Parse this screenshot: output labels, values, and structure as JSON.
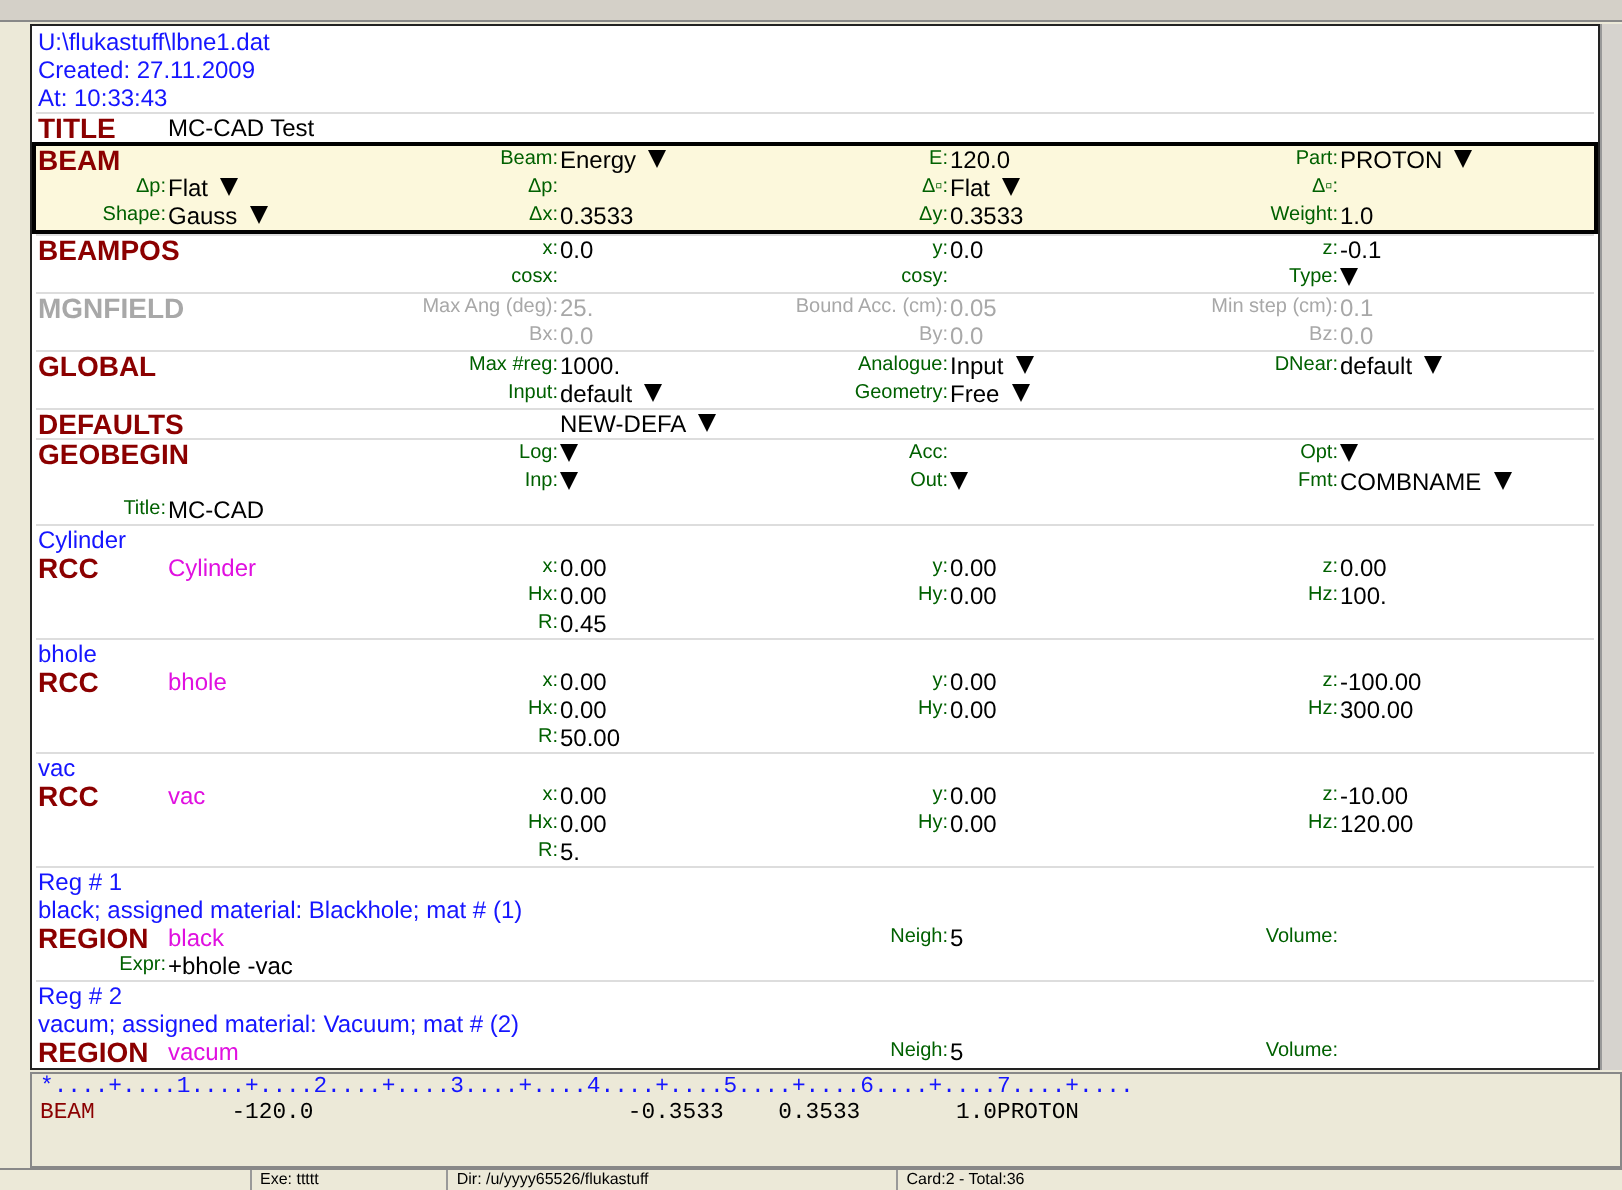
{
  "file_info": [
    "U:\\flukastuff\\lbne1.dat",
    "Created: 27.11.2009",
    "At: 10:33:43"
  ],
  "cards": [
    {
      "selected": false,
      "disabled": false,
      "rows": [
        {
          "name": "TITLE",
          "side": {
            "kind": "entry",
            "value": "MC-CAD Test"
          }
        }
      ]
    },
    {
      "selected": true,
      "disabled": false,
      "rows": [
        {
          "name": "BEAM",
          "col_1": {
            "kind": "choice",
            "label": "Beam:",
            "value": "Energy"
          },
          "col_2": {
            "kind": "entry",
            "label": "E:",
            "value": "120.0"
          },
          "col_3": {
            "kind": "choice",
            "label": "Part:",
            "value": "PROTON"
          }
        },
        {
          "side": {
            "kind": "choice",
            "label": "Δp:",
            "value": "Flat"
          },
          "col_1": {
            "kind": "entry",
            "label": "Δp:"
          },
          "col_2": {
            "kind": "choice",
            "label": "Δ▫:",
            "value": "Flat"
          },
          "col_3": {
            "kind": "entry",
            "label": "Δ▫:"
          }
        },
        {
          "side": {
            "kind": "choice",
            "label": "Shape:",
            "value": "Gauss"
          },
          "col_1": {
            "kind": "entry",
            "label": "Δx:",
            "value": "0.3533"
          },
          "col_2": {
            "kind": "entry",
            "label": "Δy:",
            "value": "0.3533"
          },
          "col_3": {
            "kind": "entry",
            "label": "Weight:",
            "value": "1.0"
          }
        }
      ]
    },
    {
      "selected": false,
      "disabled": false,
      "rows": [
        {
          "name": "BEAMPOS",
          "col_1": {
            "kind": "entry",
            "label": "x:",
            "value": "0.0"
          },
          "col_2": {
            "kind": "entry",
            "label": "y:",
            "value": "0.0"
          },
          "col_3": {
            "kind": "entry",
            "label": "z:",
            "value": "-0.1"
          }
        },
        {
          "col_1": {
            "kind": "entry",
            "label": "cosx:"
          },
          "col_2": {
            "kind": "entry",
            "label": "cosy:"
          },
          "col_3": {
            "kind": "choice",
            "label": "Type:"
          }
        }
      ]
    },
    {
      "selected": false,
      "disabled": true,
      "rows": [
        {
          "name": "MGNFIELD",
          "col_1": {
            "kind": "entry",
            "label": "Max Ang (deg):",
            "value": "25."
          },
          "col_2": {
            "kind": "entry",
            "label": "Bound Acc. (cm):",
            "value": "0.05"
          },
          "col_3": {
            "kind": "entry",
            "label": "Min step (cm):",
            "value": "0.1"
          }
        },
        {
          "col_1": {
            "kind": "entry",
            "label": "Bx:",
            "value": "0.0"
          },
          "col_2": {
            "kind": "entry",
            "label": "By:",
            "value": "0.0"
          },
          "col_3": {
            "kind": "entry",
            "label": "Bz:",
            "value": "0.0"
          }
        }
      ]
    },
    {
      "selected": false,
      "disabled": false,
      "rows": [
        {
          "name": "GLOBAL",
          "col_1": {
            "kind": "entry",
            "label": "Max #reg:",
            "value": "1000."
          },
          "col_2": {
            "kind": "choice",
            "label": "Analogue:",
            "value": "Input"
          },
          "col_3": {
            "kind": "choice",
            "label": "DNear:",
            "value": "default"
          }
        },
        {
          "col_1": {
            "kind": "choice",
            "label": "Input:",
            "value": "default"
          },
          "col_2": {
            "kind": "choice",
            "label": "Geometry:",
            "value": "Free"
          }
        }
      ]
    },
    {
      "selected": false,
      "disabled": false,
      "rows": [
        {
          "name": "DEFAULTS",
          "col_1": {
            "kind": "choice",
            "value": "NEW-DEFA"
          }
        }
      ]
    },
    {
      "selected": false,
      "disabled": false,
      "rows": [
        {
          "name": "GEOBEGIN",
          "col_1": {
            "kind": "choice",
            "label": "Log:"
          },
          "col_2": {
            "kind": "entry",
            "label": "Acc:"
          },
          "col_3": {
            "kind": "choice",
            "label": "Opt:"
          }
        },
        {
          "col_1": {
            "kind": "choice",
            "label": "Inp:"
          },
          "col_2": {
            "kind": "choice",
            "label": "Out:"
          },
          "col_3": {
            "kind": "choice",
            "label": "Fmt:",
            "value": "COMBNAME"
          }
        },
        {
          "side": {
            "kind": "entry",
            "label": "Title:",
            "value": "MC-CAD"
          }
        }
      ]
    },
    {
      "selected": false,
      "disabled": false,
      "notes": [
        "Cylinder"
      ],
      "rows": [
        {
          "name": "RCC",
          "tag": "Cylinder",
          "col_1": {
            "kind": "entry",
            "label": "x:",
            "value": "0.00"
          },
          "col_2": {
            "kind": "entry",
            "label": "y:",
            "value": "0.00"
          },
          "col_3": {
            "kind": "entry",
            "label": "z:",
            "value": "0.00"
          }
        },
        {
          "col_1": {
            "kind": "entry",
            "label": "Hx:",
            "value": "0.00"
          },
          "col_2": {
            "kind": "entry",
            "label": "Hy:",
            "value": "0.00"
          },
          "col_3": {
            "kind": "entry",
            "label": "Hz:",
            "value": "100."
          }
        },
        {
          "col_1": {
            "kind": "entry",
            "label": "R:",
            "value": "0.45"
          }
        }
      ]
    },
    {
      "selected": false,
      "disabled": false,
      "notes": [
        "bhole"
      ],
      "rows": [
        {
          "name": "RCC",
          "tag": "bhole",
          "col_1": {
            "kind": "entry",
            "label": "x:",
            "value": "0.00"
          },
          "col_2": {
            "kind": "entry",
            "label": "y:",
            "value": "0.00"
          },
          "col_3": {
            "kind": "entry",
            "label": "z:",
            "value": "-100.00"
          }
        },
        {
          "col_1": {
            "kind": "entry",
            "label": "Hx:",
            "value": "0.00"
          },
          "col_2": {
            "kind": "entry",
            "label": "Hy:",
            "value": "0.00"
          },
          "col_3": {
            "kind": "entry",
            "label": "Hz:",
            "value": "300.00"
          }
        },
        {
          "col_1": {
            "kind": "entry",
            "label": "R:",
            "value": "50.00"
          }
        }
      ]
    },
    {
      "selected": false,
      "disabled": false,
      "notes": [
        "vac"
      ],
      "rows": [
        {
          "name": "RCC",
          "tag": "vac",
          "col_1": {
            "kind": "entry",
            "label": "x:",
            "value": "0.00"
          },
          "col_2": {
            "kind": "entry",
            "label": "y:",
            "value": "0.00"
          },
          "col_3": {
            "kind": "entry",
            "label": "z:",
            "value": "-10.00"
          }
        },
        {
          "col_1": {
            "kind": "entry",
            "label": "Hx:",
            "value": "0.00"
          },
          "col_2": {
            "kind": "entry",
            "label": "Hy:",
            "value": "0.00"
          },
          "col_3": {
            "kind": "entry",
            "label": "Hz:",
            "value": "120.00"
          }
        },
        {
          "col_1": {
            "kind": "entry",
            "label": "R:",
            "value": "5."
          }
        }
      ]
    },
    {
      "selected": false,
      "disabled": false,
      "notes": [
        "Reg # 1",
        "black; assigned material: Blackhole; mat # (1)"
      ],
      "rows": [
        {
          "name": "REGION",
          "tag": "black",
          "col_2": {
            "kind": "entry",
            "label": "Neigh:",
            "value": "5"
          },
          "col_3": {
            "kind": "entry",
            "label": "Volume:"
          }
        },
        {
          "side": {
            "kind": "entry",
            "label": "Expr:",
            "value": "+bhole -vac"
          }
        }
      ]
    },
    {
      "selected": false,
      "disabled": false,
      "notes": [
        "Reg # 2",
        "vacum; assigned material: Vacuum; mat # (2)"
      ],
      "rows": [
        {
          "name": "REGION",
          "tag": "vacum",
          "col_2": {
            "kind": "entry",
            "label": "Neigh:",
            "value": "5"
          },
          "col_3": {
            "kind": "entry",
            "label": "Volume:"
          }
        }
      ]
    }
  ],
  "output": {
    "ruler": "*....+....1....+....2....+....3....+....4....+....5....+....6....+....7....+....",
    "card_name": "BEAM",
    "card_fields": "          -120.0                       -0.3533    0.3533       1.0PROTON"
  },
  "status_bar": [
    "Exe: ttttt",
    "Dir: /u/yyyy65526/flukastuff",
    "Card:2 - Total:36"
  ]
}
